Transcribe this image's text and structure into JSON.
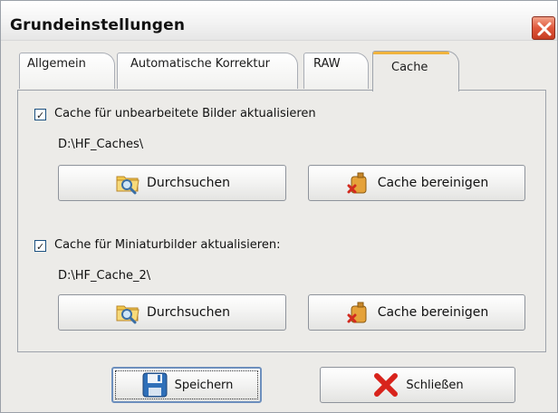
{
  "window": {
    "title": "Grundeinstellungen"
  },
  "tabs": [
    {
      "label": "Allgemein",
      "active": false
    },
    {
      "label": "Automatische Korrektur",
      "active": false
    },
    {
      "label": "RAW",
      "active": false
    },
    {
      "label": "Cache",
      "active": true
    }
  ],
  "cache_sections": [
    {
      "checkbox_label": "Cache für unbearbeitete Bilder aktualisieren",
      "checked": true,
      "path": "D:\\HF_Caches\\",
      "browse_label": "Durchsuchen",
      "clear_label": "Cache bereinigen"
    },
    {
      "checkbox_label": "Cache für Miniaturbilder aktualisieren:",
      "checked": true,
      "path": "D:\\HF_Cache_2\\",
      "browse_label": "Durchsuchen",
      "clear_label": "Cache bereinigen"
    }
  ],
  "footer": {
    "save_label": "Speichern",
    "close_label": "Schließen"
  },
  "colors": {
    "active_tab_accent": "#f0b33d",
    "close_button": "#e0573b"
  },
  "icons": {
    "close": "close-x-icon",
    "browse": "folder-search-icon",
    "clear": "jerrycan-delete-icon",
    "save": "floppy-disk-icon",
    "close_dialog": "red-x-icon"
  }
}
